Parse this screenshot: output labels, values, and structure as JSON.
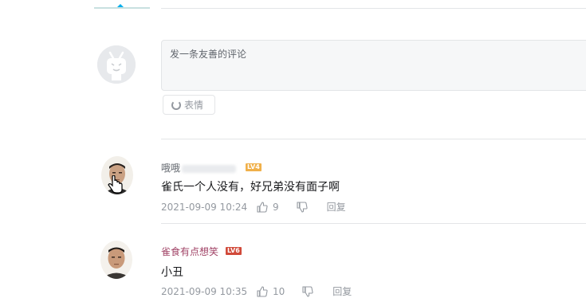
{
  "composer": {
    "placeholder": "发一条友善的评论",
    "emoji_label": "表情"
  },
  "comments": [
    {
      "user": "哦哦",
      "level": "LV4",
      "level_color": "#f0b04a",
      "text": "雀氏一个人没有，好兄弟没有面子啊",
      "time": "2021-09-09 10:24",
      "likes": "9",
      "reply_label": "回复"
    },
    {
      "user": "雀食有点想笑",
      "level": "LV6",
      "level_color": "#d14a3a",
      "text": "小丑",
      "time": "2021-09-09 10:35",
      "likes": "10",
      "reply_label": "回复"
    }
  ]
}
